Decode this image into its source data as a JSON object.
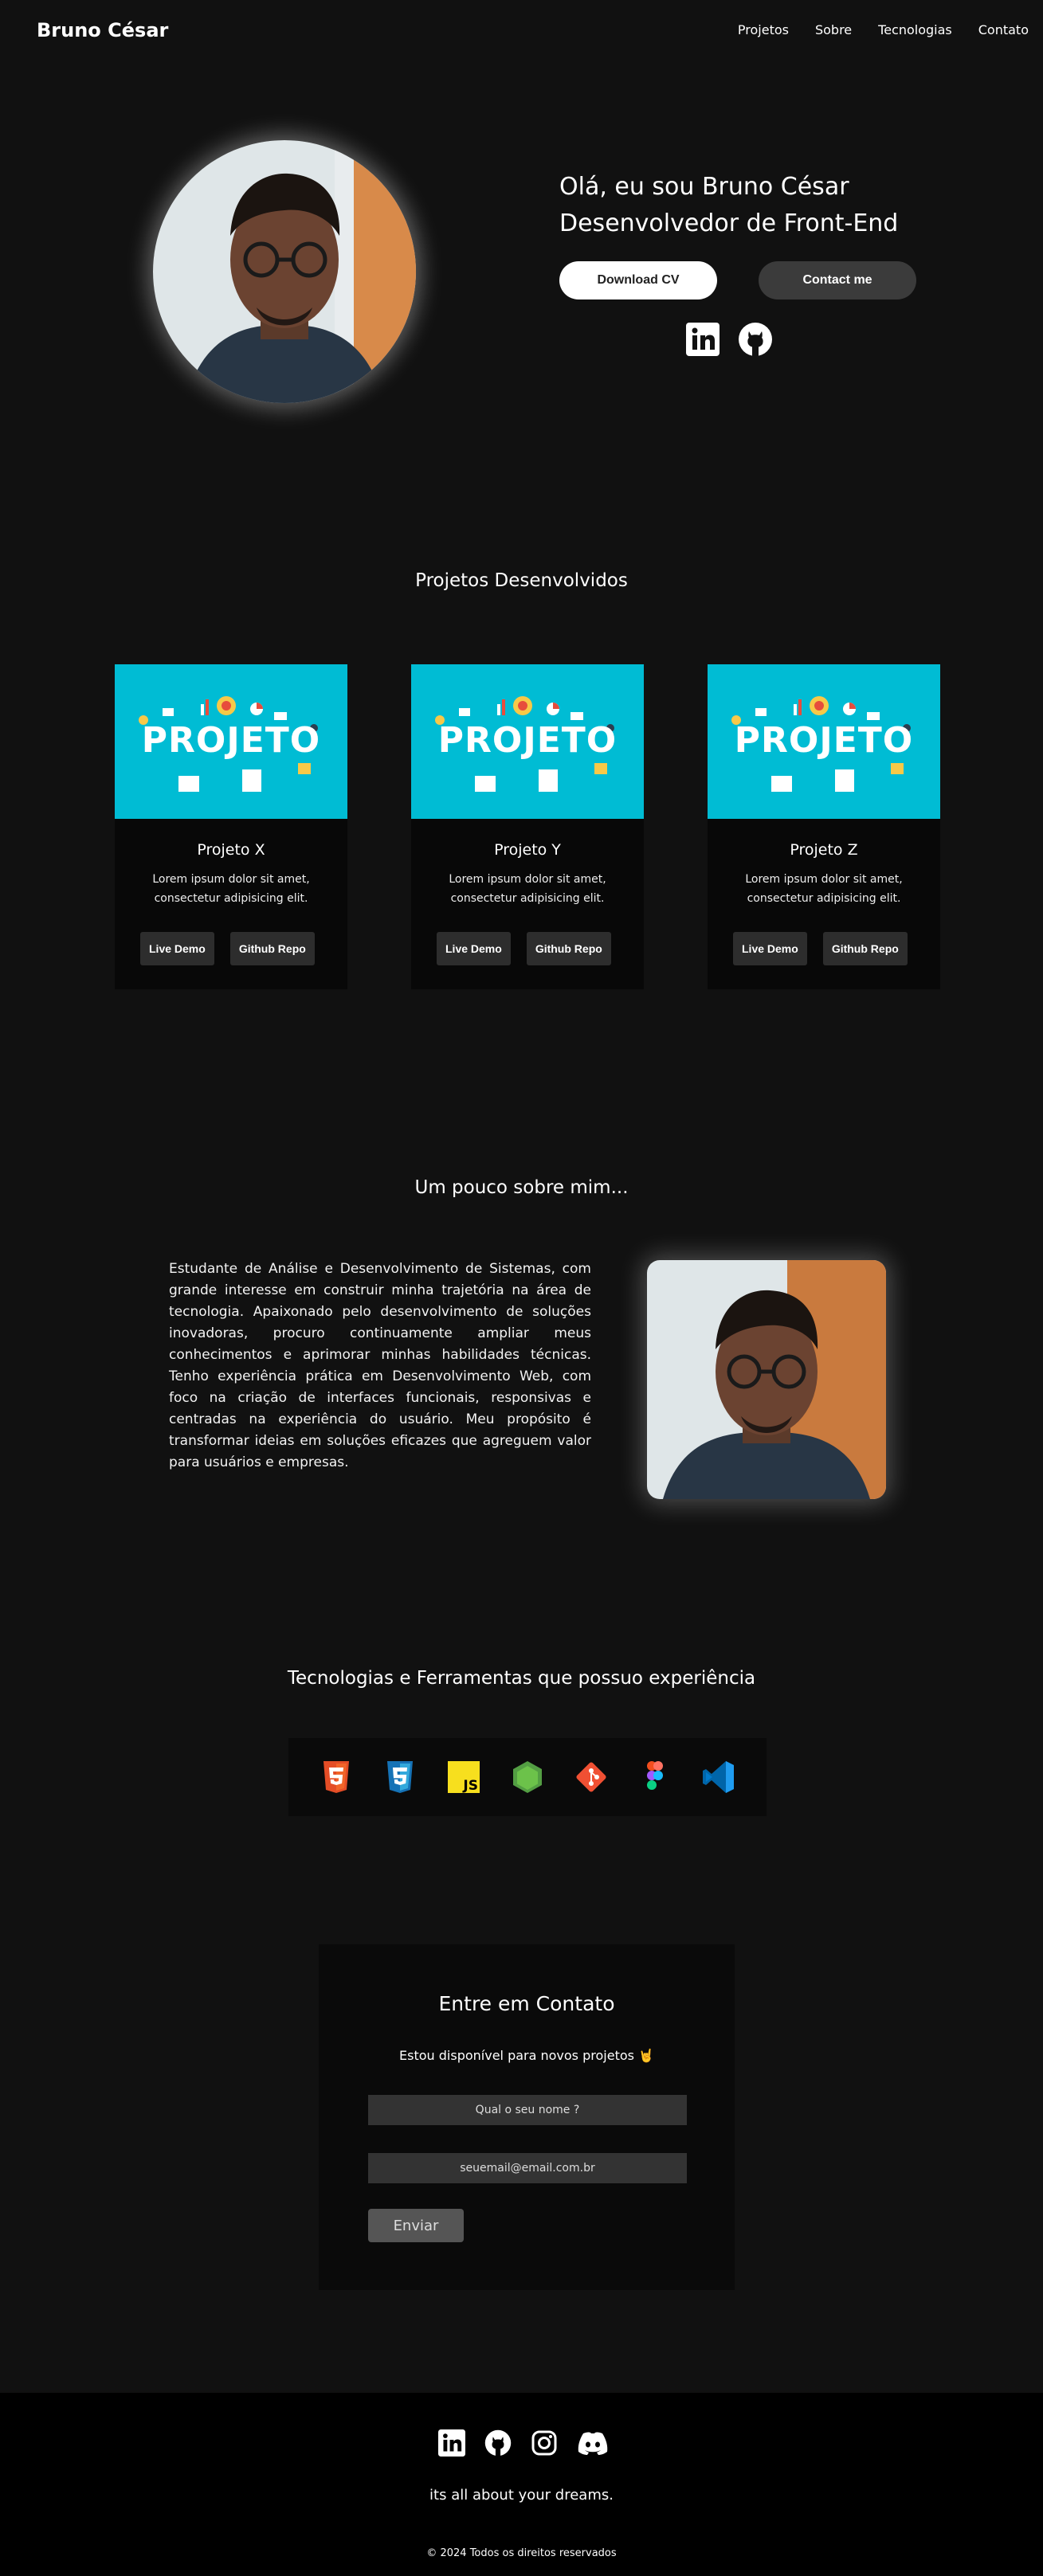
{
  "header": {
    "brand": "Bruno César",
    "nav": [
      "Projetos",
      "Sobre",
      "Tecnologias",
      "Contato"
    ]
  },
  "hero": {
    "line1": "Olá, eu sou Bruno César",
    "line2": "Desenvolvedor de Front-End",
    "download_label": "Download CV",
    "contact_label": "Contact me",
    "social_icons": [
      "linkedin-icon",
      "github-icon"
    ]
  },
  "projects": {
    "title": "Projetos Desenvolvidos",
    "thumb_text": "PROJETO",
    "items": [
      {
        "name": "Projeto X",
        "desc": "Lorem ipsum dolor sit amet, consectetur adipisicing elit.",
        "demo": "Live Demo",
        "repo": "Github Repo"
      },
      {
        "name": "Projeto Y",
        "desc": "Lorem ipsum dolor sit amet, consectetur adipisicing elit.",
        "demo": "Live Demo",
        "repo": "Github Repo"
      },
      {
        "name": "Projeto Z",
        "desc": "Lorem ipsum dolor sit amet, consectetur adipisicing elit.",
        "demo": "Live Demo",
        "repo": "Github Repo"
      }
    ]
  },
  "about": {
    "title": "Um pouco sobre mim...",
    "text": "Estudante de Análise e Desenvolvimento de Sistemas, com grande interesse em construir minha trajetória na área de tecnologia. Apaixonado pelo desenvolvimento de soluções inovadoras, procuro continuamente ampliar meus conhecimentos e aprimorar minhas habilidades técnicas. Tenho experiência prática em Desenvolvimento Web, com foco na criação de interfaces funcionais, responsivas e centradas na experiência do usuário. Meu propósito é transformar ideias em soluções eficazes que agreguem valor para usuários e empresas."
  },
  "tech": {
    "title": "Tecnologias e Ferramentas que possuo experiência",
    "icons": [
      "html5-icon",
      "css3-icon",
      "javascript-icon",
      "nodejs-icon",
      "git-icon",
      "figma-icon",
      "vscode-icon"
    ]
  },
  "contact": {
    "title": "Entre em Contato",
    "subtitle": "Estou disponível para novos projetos 🤘",
    "name_placeholder": "Qual o seu nome ?",
    "email_placeholder": "seuemail@email.com.br",
    "send_label": "Enviar"
  },
  "footer": {
    "icons": [
      "linkedin-icon",
      "github-icon",
      "instagram-icon",
      "discord-icon"
    ],
    "slogan": "its all about your dreams.",
    "copyright": "© 2024 Todos os direitos reservados"
  }
}
